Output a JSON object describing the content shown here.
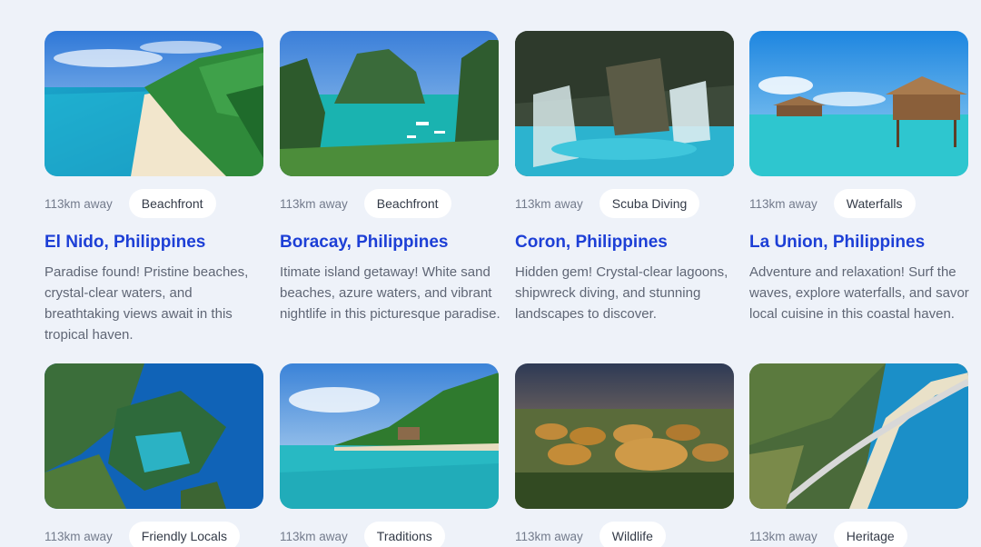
{
  "destinations": [
    {
      "distance": "113km away",
      "tag": "Beachfront",
      "title": "El Nido, Philippines",
      "description": "Paradise found! Pristine beaches, crystal-clear waters, and breathtaking views await in this tropical haven.",
      "image": "beach-shoreline-photo"
    },
    {
      "distance": "113km away",
      "tag": "Beachfront",
      "title": "Boracay, Philippines",
      "description": "Itimate island getaway! White sand beaches, azure waters, and vibrant nightlife in this picturesque paradise.",
      "image": "lagoon-cliffs-photo"
    },
    {
      "distance": "113km away",
      "tag": "Scuba Diving",
      "title": "Coron, Philippines",
      "description": "Hidden gem! Crystal-clear lagoons, shipwreck diving, and stunning landscapes to discover.",
      "image": "waterfall-pool-photo"
    },
    {
      "distance": "113km away",
      "tag": "Waterfalls",
      "title": "La Union, Philippines",
      "description": "Adventure and relaxation! Surf the waves, explore waterfalls, and savor local cuisine in this coastal haven.",
      "image": "stilt-huts-photo"
    },
    {
      "distance": "113km away",
      "tag": "Friendly Locals",
      "image": "aerial-islands-photo"
    },
    {
      "distance": "113km away",
      "tag": "Traditions",
      "image": "palm-island-photo"
    },
    {
      "distance": "113km away",
      "tag": "Wildlife",
      "image": "chocolate-hills-photo"
    },
    {
      "distance": "113km away",
      "tag": "Heritage",
      "image": "coastal-road-photo"
    }
  ],
  "colors": {
    "background": "#eef2f9",
    "title": "#1d3fd6",
    "tag_background": "#ffffff"
  }
}
